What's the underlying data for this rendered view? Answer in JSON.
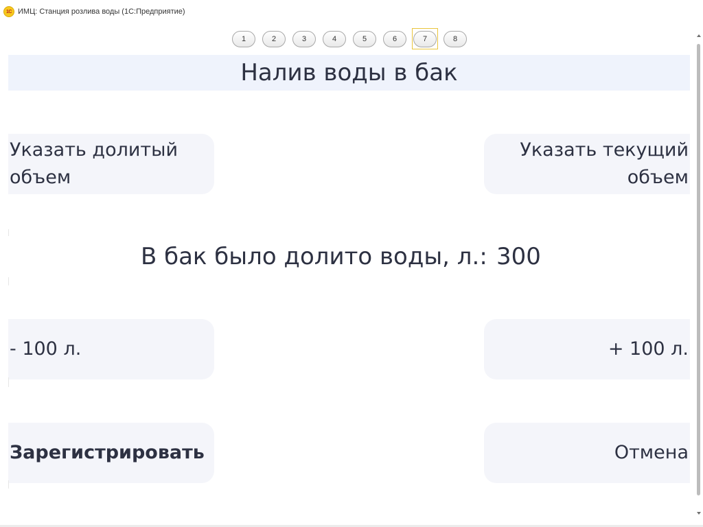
{
  "window": {
    "logo_text": "1С",
    "title": "ИМЦ: Станция розлива воды  (1С:Предприятие)"
  },
  "page_tabs": [
    {
      "label": "1"
    },
    {
      "label": "2"
    },
    {
      "label": "3"
    },
    {
      "label": "4"
    },
    {
      "label": "5"
    },
    {
      "label": "6"
    },
    {
      "label": "7",
      "active": true
    },
    {
      "label": "8"
    }
  ],
  "header": {
    "title": "Налив воды в бак"
  },
  "buttons": {
    "added_volume": [
      "Указать долитый",
      "объем"
    ],
    "current_volume": [
      "Указать текущий",
      "объем"
    ],
    "minus": "- 100 л.",
    "plus": "+ 100 л.",
    "register": "Зарегистрировать",
    "cancel": "Отмена"
  },
  "volume": {
    "label": "В бак было долито воды, л.:",
    "value": "300"
  },
  "colors": {
    "header_bg": "#eff3fc",
    "button_bg": "#f4f5fa",
    "text": "#2d3142",
    "active_tab_border": "#e9c43b"
  }
}
